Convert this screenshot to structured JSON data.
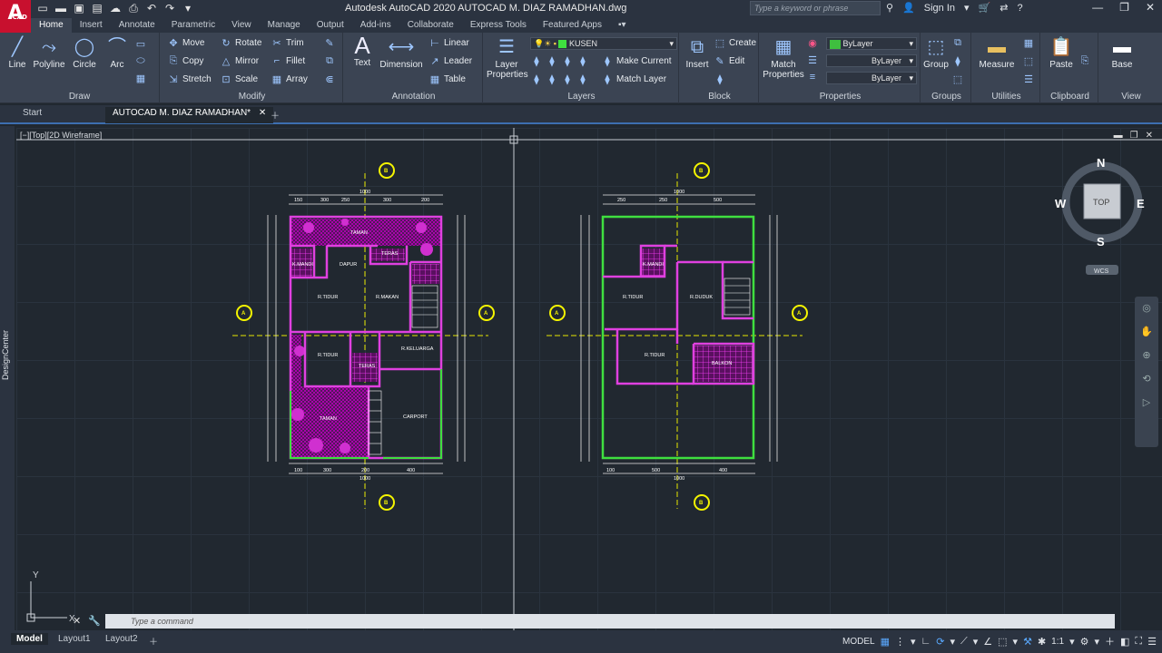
{
  "titlebar": {
    "logo": "A",
    "logo_sub": "CAD",
    "title": "Autodesk AutoCAD 2020   AUTOCAD M. DIAZ RAMADHAN.dwg",
    "search_placeholder": "Type a keyword or phrase",
    "sign_in": "Sign In"
  },
  "ribbon_tabs": [
    "Home",
    "Insert",
    "Annotate",
    "Parametric",
    "View",
    "Manage",
    "Output",
    "Add-ins",
    "Collaborate",
    "Express Tools",
    "Featured Apps"
  ],
  "draw": {
    "title": "Draw",
    "line": "Line",
    "polyline": "Polyline",
    "circle": "Circle",
    "arc": "Arc"
  },
  "modify": {
    "title": "Modify",
    "move": "Move",
    "rotate": "Rotate",
    "trim": "Trim",
    "copy": "Copy",
    "mirror": "Mirror",
    "fillet": "Fillet",
    "stretch": "Stretch",
    "scale": "Scale",
    "array": "Array"
  },
  "annotation": {
    "title": "Annotation",
    "text": "Text",
    "dimension": "Dimension",
    "linear": "Linear",
    "leader": "Leader",
    "table": "Table"
  },
  "layers": {
    "title": "Layers",
    "layer_properties": "Layer Properties",
    "current_layer": "KUSEN",
    "make_current": "Make Current",
    "match_layer": "Match Layer"
  },
  "block": {
    "title": "Block",
    "insert": "Insert",
    "create": "Create",
    "edit": "Edit"
  },
  "properties": {
    "title": "Properties",
    "match": "Match Properties",
    "color": "ByLayer",
    "linetype": "ByLayer",
    "lineweight": "ByLayer"
  },
  "groups": {
    "title": "Groups",
    "group": "Group"
  },
  "utilities": {
    "title": "Utilities",
    "measure": "Measure"
  },
  "clipboard": {
    "title": "Clipboard",
    "paste": "Paste"
  },
  "view": {
    "title": "View",
    "base": "Base"
  },
  "file_tabs": {
    "start": "Start",
    "active": "AUTOCAD M. DIAZ RAMADHAN*"
  },
  "viewport": {
    "label": "[−][Top][2D Wireframe]"
  },
  "left_palette": "DesignCenter",
  "viewcube": {
    "n": "N",
    "s": "S",
    "e": "E",
    "w": "W",
    "top": "TOP",
    "wcs": "WCS"
  },
  "ucs": {
    "y": "Y",
    "x": "X"
  },
  "plan_left": {
    "rooms": [
      "TAMAN",
      "K.MANDI",
      "DAPUR",
      "TERAS",
      "R.TIDUR",
      "R.MAKAN",
      "R.TIDUR",
      "R.KELUARGA",
      "TERAS",
      "TAMAN",
      "CARPORT"
    ],
    "dims_top": [
      "150",
      "300",
      "250",
      "300",
      "200"
    ],
    "dim_total": "1000",
    "dims_bottom": [
      "100",
      "300",
      "200",
      "400"
    ]
  },
  "plan_right": {
    "rooms": [
      "K.MANDI",
      "R.TIDUR",
      "R.DUDUK",
      "R.TIDUR",
      "BALKON"
    ],
    "dims_top": [
      "250",
      "250",
      "500"
    ],
    "dim_total": "1000",
    "dims_bottom": [
      "100",
      "500",
      "400"
    ]
  },
  "section_markers": {
    "b": "B",
    "a": "A"
  },
  "command": {
    "placeholder": "Type  a  command"
  },
  "layout_tabs": [
    "Model",
    "Layout1",
    "Layout2"
  ],
  "status": {
    "model": "MODEL",
    "scale": "1:1"
  },
  "colors": {
    "accent": "#3d6fb0",
    "canvas": "#212830",
    "wall_magenta": "#e040e0",
    "hatch": "#c000c0",
    "wall_green": "#3fdf3f",
    "marker_yellow": "#f5f500"
  }
}
